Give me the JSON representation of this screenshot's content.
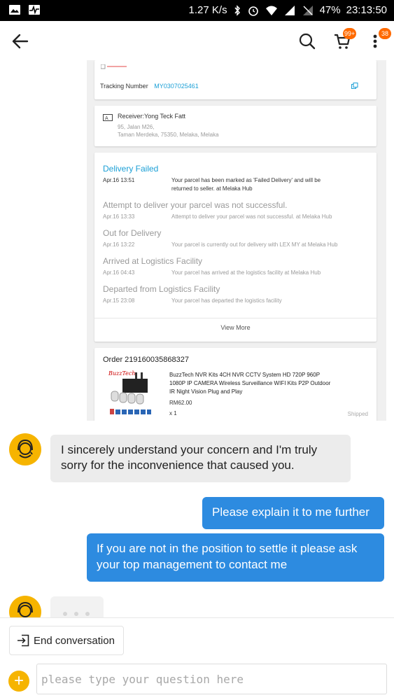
{
  "status_bar": {
    "speed": "1.27 K/s",
    "battery": "47%",
    "time": "23:13:50"
  },
  "app_bar": {
    "cart_badge": "99+",
    "more_badge": "38"
  },
  "shipment": {
    "tracking_label": "Tracking Number",
    "tracking_number": "MY0307025461",
    "receiver_label": "Receiver:Yong Teck Fatt",
    "address_line1": "95, Jalan M26,",
    "address_line2": "Taman Merdeka, 75350, Melaka, Melaka",
    "events": [
      {
        "title": "Delivery Failed",
        "date": "Apr.16 13:51",
        "desc_line1": "Your parcel has been marked as 'Failed Delivery' and will be",
        "desc_line2": "returned to seller. at Melaka Hub"
      },
      {
        "title": "Attempt to deliver your parcel was not successful.",
        "date": "Apr.16 13:33",
        "desc_line1": "Attempt to deliver your parcel was not successful. at Melaka Hub",
        "desc_line2": ""
      },
      {
        "title": "Out for Delivery",
        "date": "Apr.16 13:22",
        "desc_line1": "Your parcel is currently out for delivery with LEX MY at Melaka Hub",
        "desc_line2": ""
      },
      {
        "title": "Arrived at Logistics Facility",
        "date": "Apr.16 04:43",
        "desc_line1": "Your parcel has arrived at the logistics facility at Melaka Hub",
        "desc_line2": ""
      },
      {
        "title": "Departed from Logistics Facility",
        "date": "Apr.15 23:08",
        "desc_line1": "Your parcel has departed the logistics facility",
        "desc_line2": ""
      }
    ],
    "view_more": "View More"
  },
  "order": {
    "label": "Order 219160035868327",
    "brand": "BuzzTech",
    "product_line1": "BuzzTech NVR Kits 4CH NVR CCTV System HD 720P 960P",
    "product_line2": "1080P IP CAMERA Wireless Surveillance WIFI Kits P2P Outdoor",
    "product_line3": "IR Night Vision Plug and Play",
    "price": "RM62.00",
    "quantity": "x 1",
    "status": "Shipped"
  },
  "chat": {
    "agent_message_line1": "I sincerely understand your concern and I'm truly",
    "agent_message_line2": "sorry for the inconvenience that caused you.",
    "user_message_1": "Please explain it to me further",
    "user_message_2_line1": "If you are not in the position to settle it please ask",
    "user_message_2_line2": "your top management to contact me"
  },
  "bottom": {
    "end_label": "End conversation",
    "input_placeholder": "please type your question here"
  },
  "colors": {
    "accent_blue": "#2d8be0",
    "agent_yellow": "#f6b400",
    "badge_orange": "#ff6a00",
    "tracking_blue": "#1a9fd6"
  }
}
